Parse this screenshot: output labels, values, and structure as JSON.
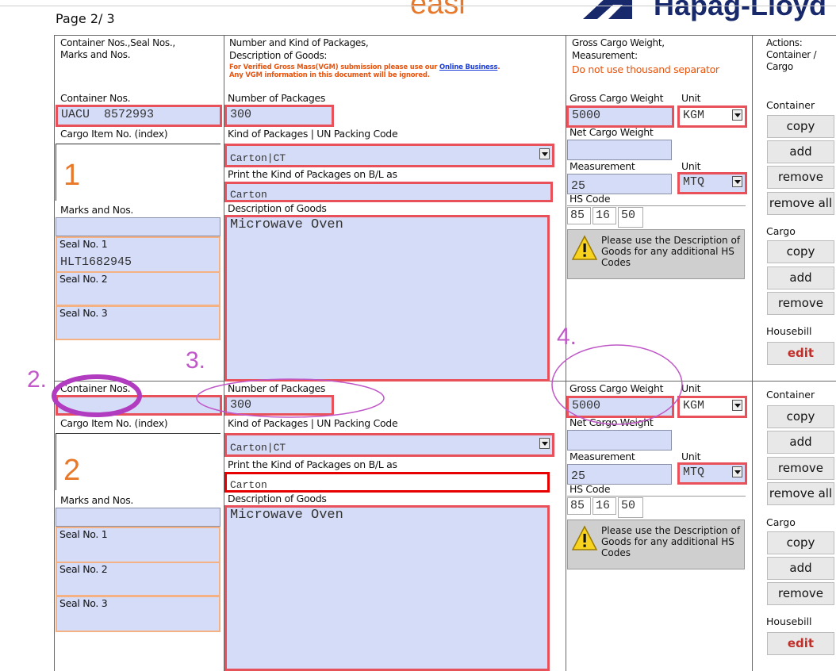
{
  "page": {
    "page_label": "Page 2/ 3",
    "logo_easi": "easi",
    "logo_hl": "Hapag-Lloyd"
  },
  "headers": {
    "col1": "Container Nos.,Seal Nos., Marks and Nos.",
    "col2_line1": "Number and Kind of Packages,",
    "col2_line2": "Description of Goods:",
    "col2_warn1": "For Verified Gross Mass(VGM) submission please use our",
    "col2_warn_link": "Online Business",
    "col2_warn2": "Any VGM information in this document will be ignored.",
    "col3_line1": "Gross Cargo Weight,",
    "col3_line2": "Measurement:",
    "col3_warn": "Do not use thousand separator",
    "col4": "Actions: Container / Cargo"
  },
  "labels": {
    "container_nos": "Container Nos.",
    "cargo_item_no": "Cargo Item No. (index)",
    "marks_and_nos": "Marks and Nos.",
    "seal1": "Seal No. 1",
    "seal2": "Seal No. 2",
    "seal3": "Seal No. 3",
    "num_packages": "Number of Packages",
    "kind_packages": "Kind of Packages | UN Packing Code",
    "print_kind": "Print the Kind of Packages on B/L as",
    "desc_goods": "Description of Goods",
    "gross_weight": "Gross Cargo Weight",
    "unit": "Unit",
    "net_weight": "Net Cargo Weight",
    "measurement": "Measurement",
    "hs_code": "HS Code",
    "hs_note": "Please use the Description of Goods for any additional HS Codes"
  },
  "actions": {
    "container": "Container",
    "cargo": "Cargo",
    "housebill": "Housebill",
    "copy": "copy",
    "add": "add",
    "remove": "remove",
    "remove_all": "remove all",
    "edit": "edit"
  },
  "items": [
    {
      "index": "1",
      "container_no": "UACU  8572993",
      "seal1": "HLT1682945",
      "seal2": "",
      "seal3": "",
      "marks": "",
      "num_packages": "300",
      "kind_packages": "Carton|CT",
      "print_kind": "Carton",
      "description": "Microwave Oven",
      "gross_weight": "5000",
      "weight_unit": "KGM",
      "net_weight": "",
      "measurement": "25",
      "measure_unit": "MTQ",
      "hs": [
        "85",
        "16",
        "50"
      ]
    },
    {
      "index": "2",
      "container_no": "",
      "seal1": "",
      "seal2": "",
      "seal3": "",
      "marks": "",
      "num_packages": "300",
      "kind_packages": "Carton|CT",
      "print_kind": "Carton",
      "description": "Microwave Oven",
      "gross_weight": "5000",
      "weight_unit": "KGM",
      "net_weight": "",
      "measurement": "25",
      "measure_unit": "MTQ",
      "hs": [
        "85",
        "16",
        "50"
      ]
    }
  ],
  "annotations": {
    "a2": "2.",
    "a3": "3.",
    "a4": "4."
  },
  "colors": {
    "field_bg": "#d5dcf8",
    "required_border": "#e8505a",
    "accent_orange": "#e8792a",
    "annotation_purple": "#c058c8"
  }
}
